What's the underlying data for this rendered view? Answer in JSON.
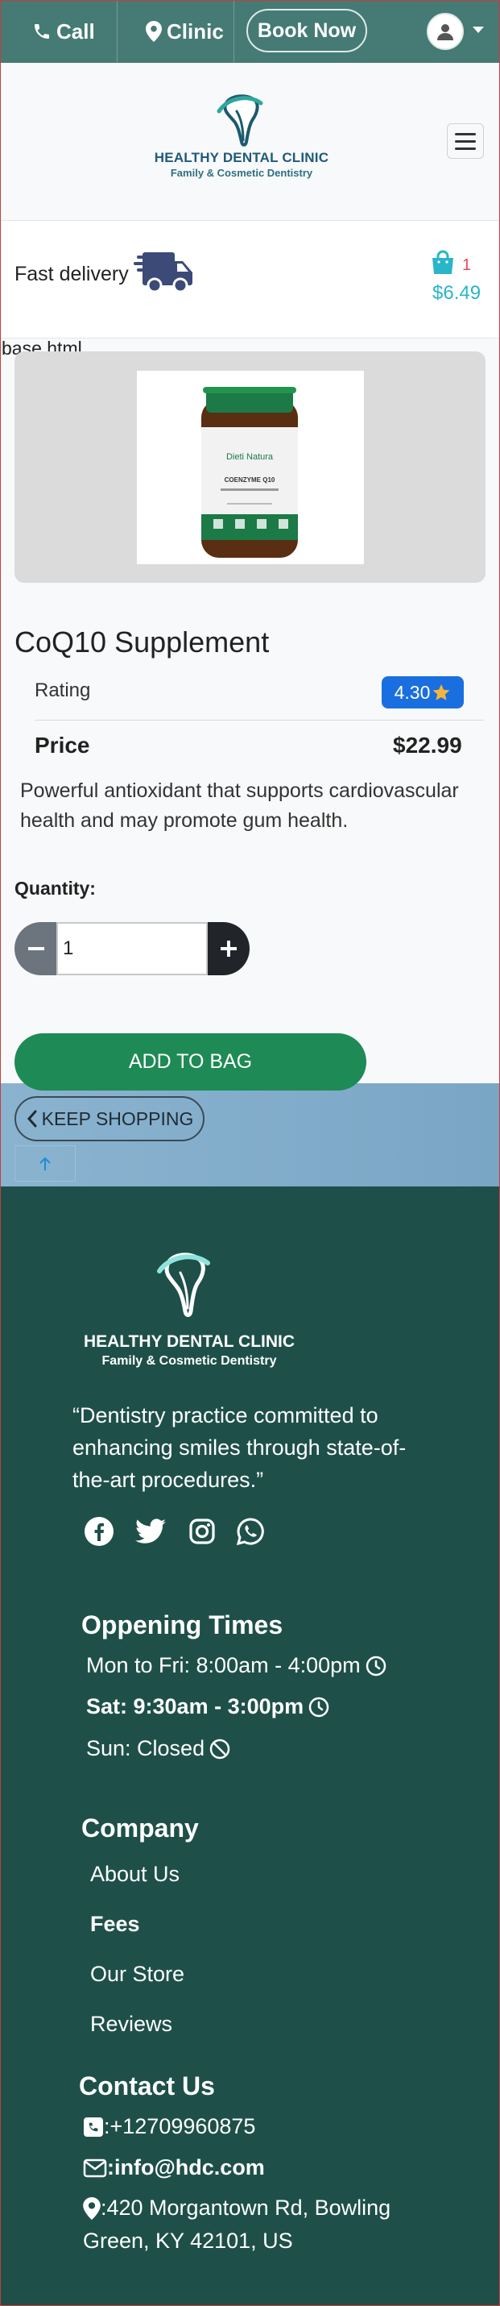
{
  "topbar": {
    "call_label": "Call",
    "clinic_label": "Clinic",
    "book_label": "Book Now"
  },
  "brand": {
    "name": "HEALTHY DENTAL CLINIC",
    "tagline": "Family & Cosmetic Dentistry"
  },
  "delivery": {
    "label": "Fast delivery",
    "cart_count": "1",
    "cart_total": "$6.49"
  },
  "page_label": "base.html",
  "product": {
    "name": "CoQ10 Supplement",
    "rating_label": "Rating",
    "rating_value": "4.30",
    "price_label": "Price",
    "price_value": "$22.99",
    "description": "Powerful antioxidant that supports cardiovascular health and may promote gum health.",
    "quantity_label": "Quantity:",
    "quantity_value": "1",
    "add_label": "ADD TO BAG",
    "keep_label": "KEEP SHOPPING",
    "bottle": {
      "brand": "Dieti Natura",
      "product": "COENZYME Q10"
    }
  },
  "footer": {
    "quote": "“Dentistry practice committed to enhancing smiles through state-of-the-art procedures.”",
    "hours_title": "Oppening Times",
    "hours": [
      "Mon to Fri: 8:00am - 4:00pm",
      "Sat: 9:30am - 3:00pm",
      "Sun: Closed"
    ],
    "company_title": "Company",
    "company_links": [
      "About Us",
      "Fees",
      "Our Store",
      "Reviews"
    ],
    "contact_title": "Contact Us",
    "phone": ":+12709960875",
    "email": ":info@hdc.com",
    "address_line1": ":420 Morgantown Rd, Bowling",
    "address_line2": "Green, KY 42101, US"
  },
  "colors": {
    "topbar": "#457b74",
    "footer": "#1e5049",
    "add_button": "#1e8a55",
    "rating_badge": "#1a6fe0",
    "cart_accent": "#2bb5c9"
  },
  "icons": [
    "phone-icon",
    "map-marker-icon",
    "user-icon",
    "logo-tooth-icon",
    "menu-icon",
    "truck-icon",
    "shopping-bag-icon",
    "star-icon",
    "minus-icon",
    "plus-icon",
    "chevron-left-icon",
    "arrow-up-icon",
    "facebook-icon",
    "twitter-icon",
    "instagram-icon",
    "whatsapp-icon",
    "clock-icon",
    "ban-icon",
    "phone-square-icon",
    "envelope-icon"
  ]
}
